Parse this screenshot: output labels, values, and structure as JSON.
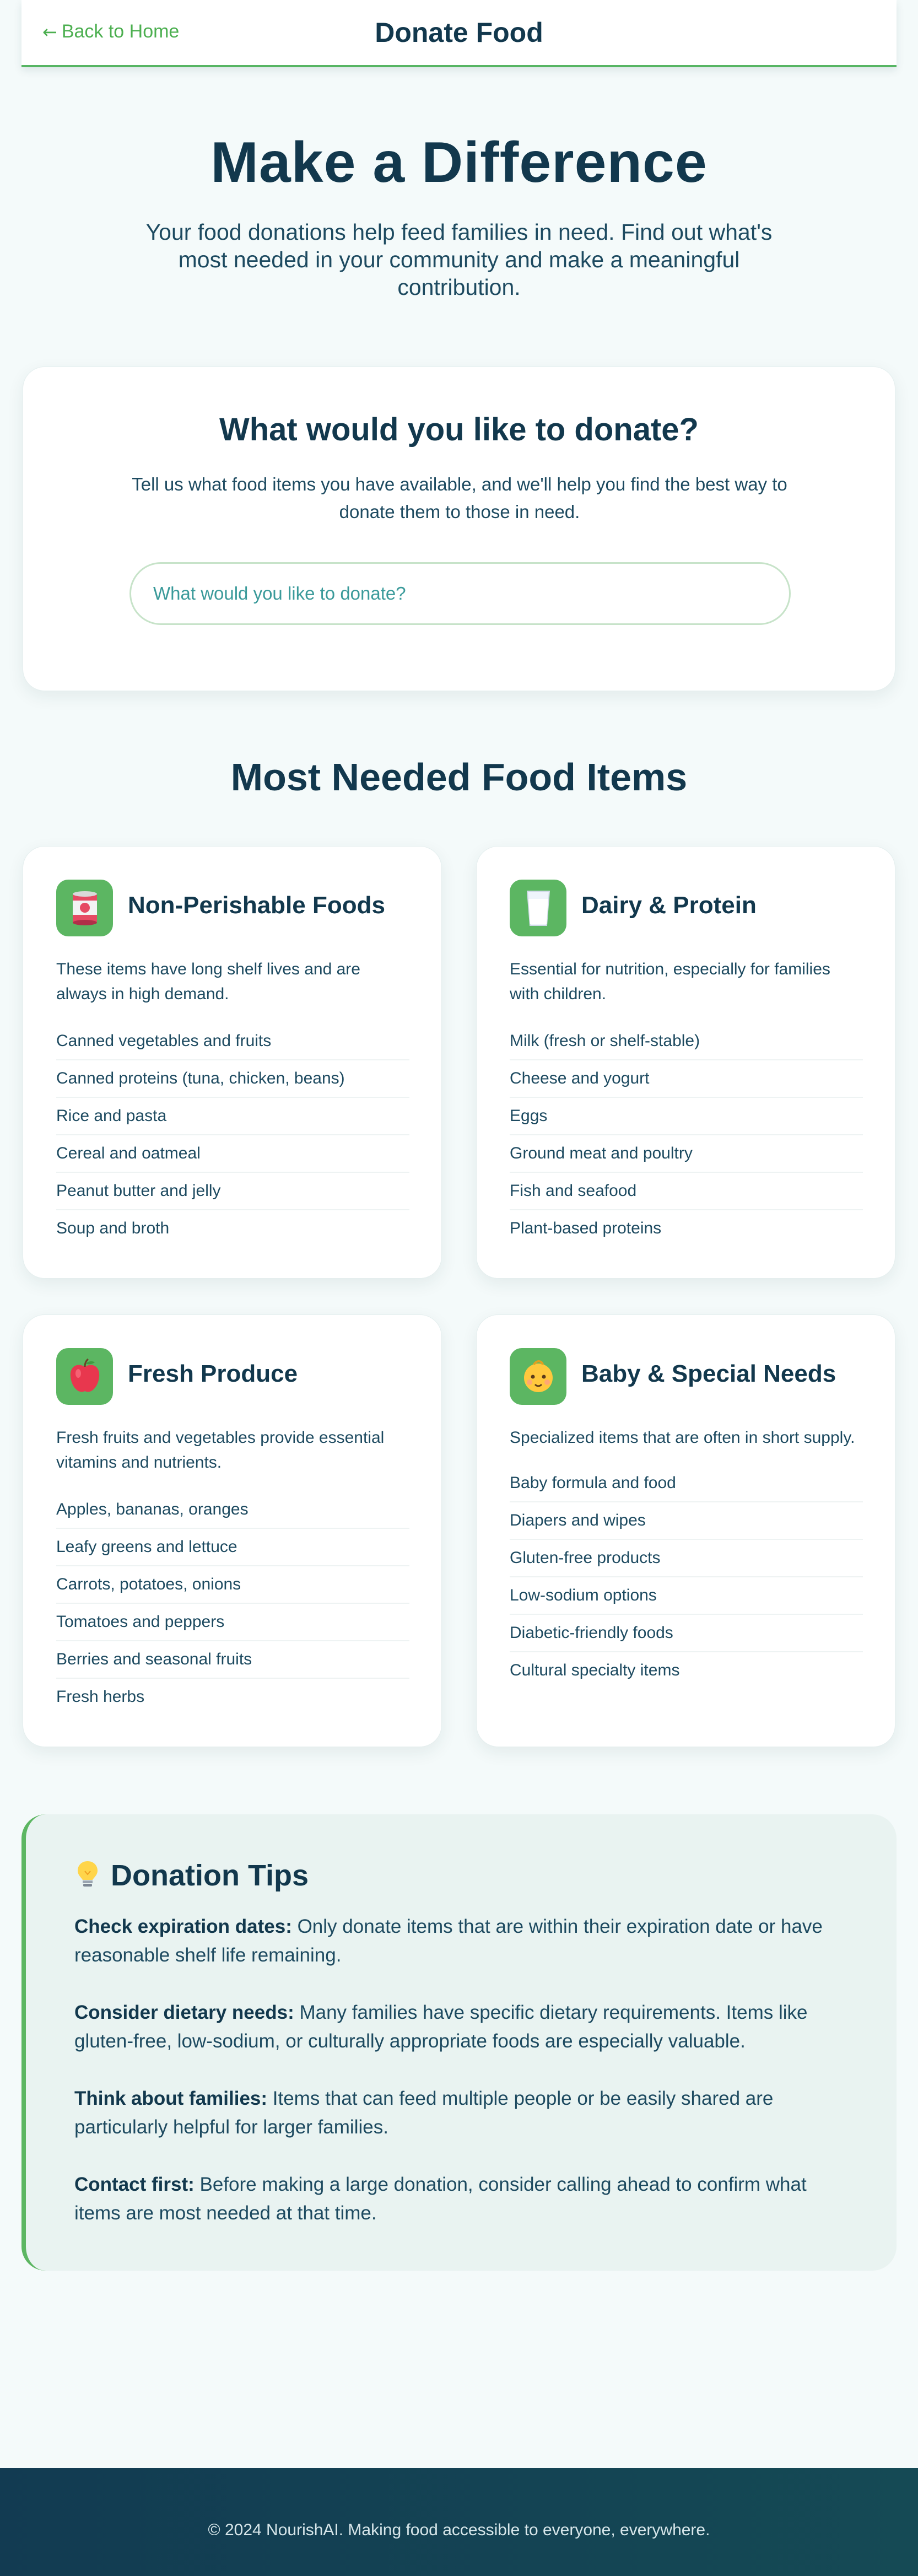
{
  "header": {
    "back_label": "Back to Home",
    "back_arrow": "←",
    "title": "Donate Food"
  },
  "hero": {
    "title": "Make a Difference",
    "subtitle": "Your food donations help feed families in need. Find out what's most needed in your community and make a meaningful contribution."
  },
  "donate": {
    "title": "What would you like to donate?",
    "description": "Tell us what food items you have available, and we'll help you find the best way to donate them to those in need.",
    "input_placeholder": "What would you like to donate?",
    "input_value": ""
  },
  "needed": {
    "title": "Most Needed Food Items",
    "categories": [
      {
        "icon": "canned-food-icon",
        "title": "Non-Perishable Foods",
        "description": "These items have long shelf lives and are always in high demand.",
        "items": [
          "Canned vegetables and fruits",
          "Canned proteins (tuna, chicken, beans)",
          "Rice and pasta",
          "Cereal and oatmeal",
          "Peanut butter and jelly",
          "Soup and broth"
        ]
      },
      {
        "icon": "milk-glass-icon",
        "title": "Dairy & Protein",
        "description": "Essential for nutrition, especially for families with children.",
        "items": [
          "Milk (fresh or shelf-stable)",
          "Cheese and yogurt",
          "Eggs",
          "Ground meat and poultry",
          "Fish and seafood",
          "Plant-based proteins"
        ]
      },
      {
        "icon": "apple-icon",
        "title": "Fresh Produce",
        "description": "Fresh fruits and vegetables provide essential vitamins and nutrients.",
        "items": [
          "Apples, bananas, oranges",
          "Leafy greens and lettuce",
          "Carrots, potatoes, onions",
          "Tomatoes and peppers",
          "Berries and seasonal fruits",
          "Fresh herbs"
        ]
      },
      {
        "icon": "baby-icon",
        "title": "Baby & Special Needs",
        "description": "Specialized items that are often in short supply.",
        "items": [
          "Baby formula and food",
          "Diapers and wipes",
          "Gluten-free products",
          "Low-sodium options",
          "Diabetic-friendly foods",
          "Cultural specialty items"
        ]
      }
    ]
  },
  "tips": {
    "icon": "lightbulb-icon",
    "title": "Donation Tips",
    "items": [
      {
        "label": "Check expiration dates:",
        "text": " Only donate items that are within their expiration date or have reasonable shelf life remaining."
      },
      {
        "label": "Consider dietary needs:",
        "text": " Many families have specific dietary requirements. Items like gluten-free, low-sodium, or culturally appropriate foods are especially valuable."
      },
      {
        "label": "Think about families:",
        "text": " Items that can feed multiple people or be easily shared are particularly helpful for larger families."
      },
      {
        "label": "Contact first:",
        "text": " Before making a large donation, consider calling ahead to confirm what items are most needed at that time."
      }
    ]
  },
  "footer": {
    "text": "© 2024 NourishAI. Making food accessible to everyone, everywhere."
  },
  "colors": {
    "accent": "#5cb662",
    "heading": "#12384d",
    "background": "#f4fafa",
    "footer": "#123b52"
  }
}
